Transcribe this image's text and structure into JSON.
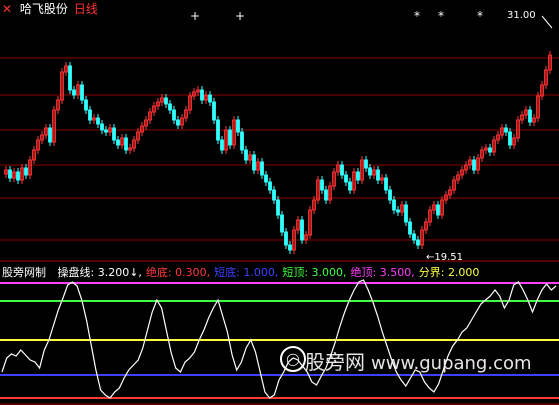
{
  "header": {
    "close_glyph": "✕",
    "stock_name": "哈飞股份",
    "period": "日线"
  },
  "price_labels": {
    "high": "31.00",
    "low": "19.51"
  },
  "indicator": {
    "name": "股旁网制",
    "items": [
      {
        "label": "操盘线",
        "value": "3.200",
        "arrow": "↓",
        "color": "#ffffff"
      },
      {
        "label": "绝底",
        "value": "0.300",
        "color": "#ff3b3b"
      },
      {
        "label": "短底",
        "value": "1.000",
        "color": "#4040ff"
      },
      {
        "label": "短顶",
        "value": "3.000",
        "color": "#40ff40"
      },
      {
        "label": "绝顶",
        "value": "3.500",
        "color": "#ff40ff"
      },
      {
        "label": "分界",
        "value": "2.000",
        "color": "#ffff40"
      }
    ]
  },
  "watermark": {
    "text": "股旁网",
    "url": "www.gupang.com"
  },
  "colors": {
    "up": "#ff3333",
    "down": "#33ffff",
    "grid": "#8b0000",
    "line": "#ffffff",
    "level_top": "#ff40ff",
    "level_short_top": "#40ff40",
    "level_mid": "#ffff40",
    "level_short_bottom": "#4040ff",
    "level_bottom": "#ff3b3b"
  }
}
